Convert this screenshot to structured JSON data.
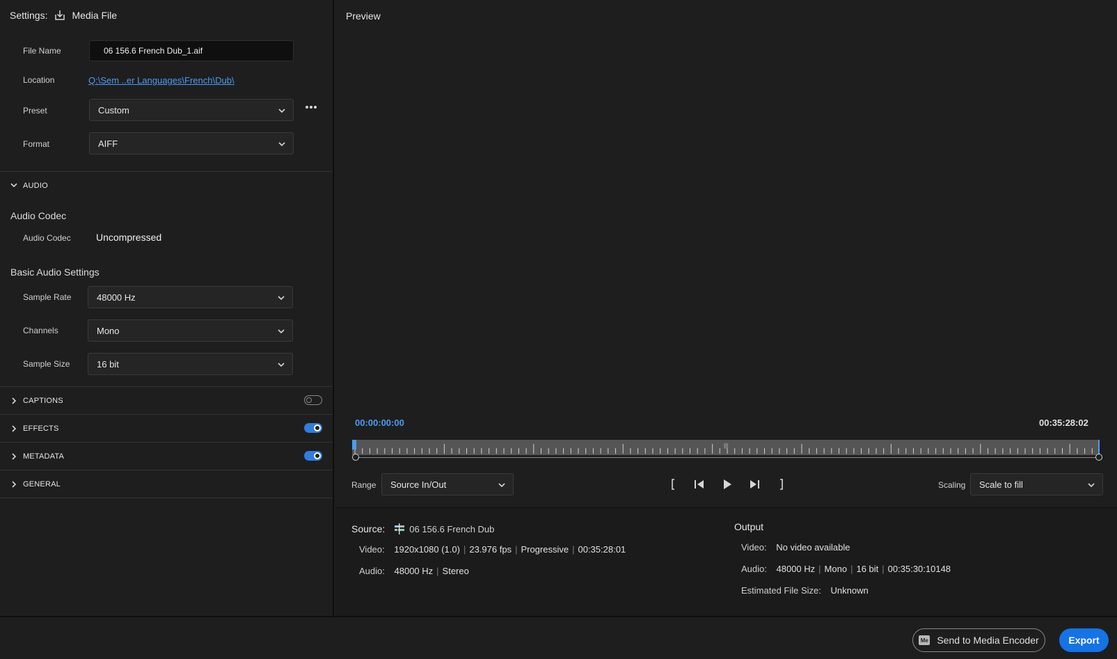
{
  "settings": {
    "label": "Settings:",
    "destination_icon": "export-to-file-icon",
    "destination": "Media File",
    "file_name_label": "File Name",
    "file_name_value": "06 156.6 French Dub_1.aif",
    "location_label": "Location",
    "location_value": "Q:\\Sem ..er Languages\\French\\Dub\\",
    "preset_label": "Preset",
    "preset_value": "Custom",
    "more_icon": "more-horizontal-icon",
    "format_label": "Format",
    "format_value": "AIFF"
  },
  "audio": {
    "section_title": "AUDIO",
    "codec_heading": "Audio Codec",
    "codec_label": "Audio Codec",
    "codec_value": "Uncompressed",
    "basic_heading": "Basic Audio Settings",
    "sample_rate_label": "Sample Rate",
    "sample_rate_value": "48000 Hz",
    "channels_label": "Channels",
    "channels_value": "Mono",
    "sample_size_label": "Sample Size",
    "sample_size_value": "16 bit"
  },
  "sections": [
    {
      "title": "CAPTIONS",
      "toggle": false
    },
    {
      "title": "EFFECTS",
      "toggle": true
    },
    {
      "title": "METADATA",
      "toggle": true
    },
    {
      "title": "GENERAL"
    }
  ],
  "preview": {
    "title": "Preview",
    "timecode_start": "00:00:00:00",
    "timecode_end": "00:35:28:02",
    "range_label": "Range",
    "range_value": "Source In/Out",
    "scaling_label": "Scaling",
    "scaling_value": "Scale to fill",
    "transport_icons": [
      "mark-in-icon",
      "step-back-icon",
      "play-icon",
      "step-forward-icon",
      "mark-out-icon"
    ]
  },
  "source": {
    "label": "Source:",
    "icon": "sequence-icon",
    "name": "06 156.6 French Dub",
    "video_label": "Video:",
    "video_parts": [
      "1920x1080 (1.0)",
      "23.976 fps",
      "Progressive",
      "00:35:28:01"
    ],
    "audio_label": "Audio:",
    "audio_parts": [
      "48000 Hz",
      "Stereo"
    ]
  },
  "output": {
    "title": "Output",
    "video_label": "Video:",
    "video_value": "No video available",
    "audio_label": "Audio:",
    "audio_parts": [
      "48000 Hz",
      "Mono",
      "16 bit",
      "00:35:30:10148"
    ],
    "size_label": "Estimated File Size:",
    "size_value": "Unknown"
  },
  "footer": {
    "send_label": "Send to Media Encoder",
    "send_icon_text": "Me",
    "export_label": "Export"
  },
  "colors": {
    "accent": "#1473e6",
    "link": "#4b9cf5",
    "background": "#1e1e1e"
  }
}
